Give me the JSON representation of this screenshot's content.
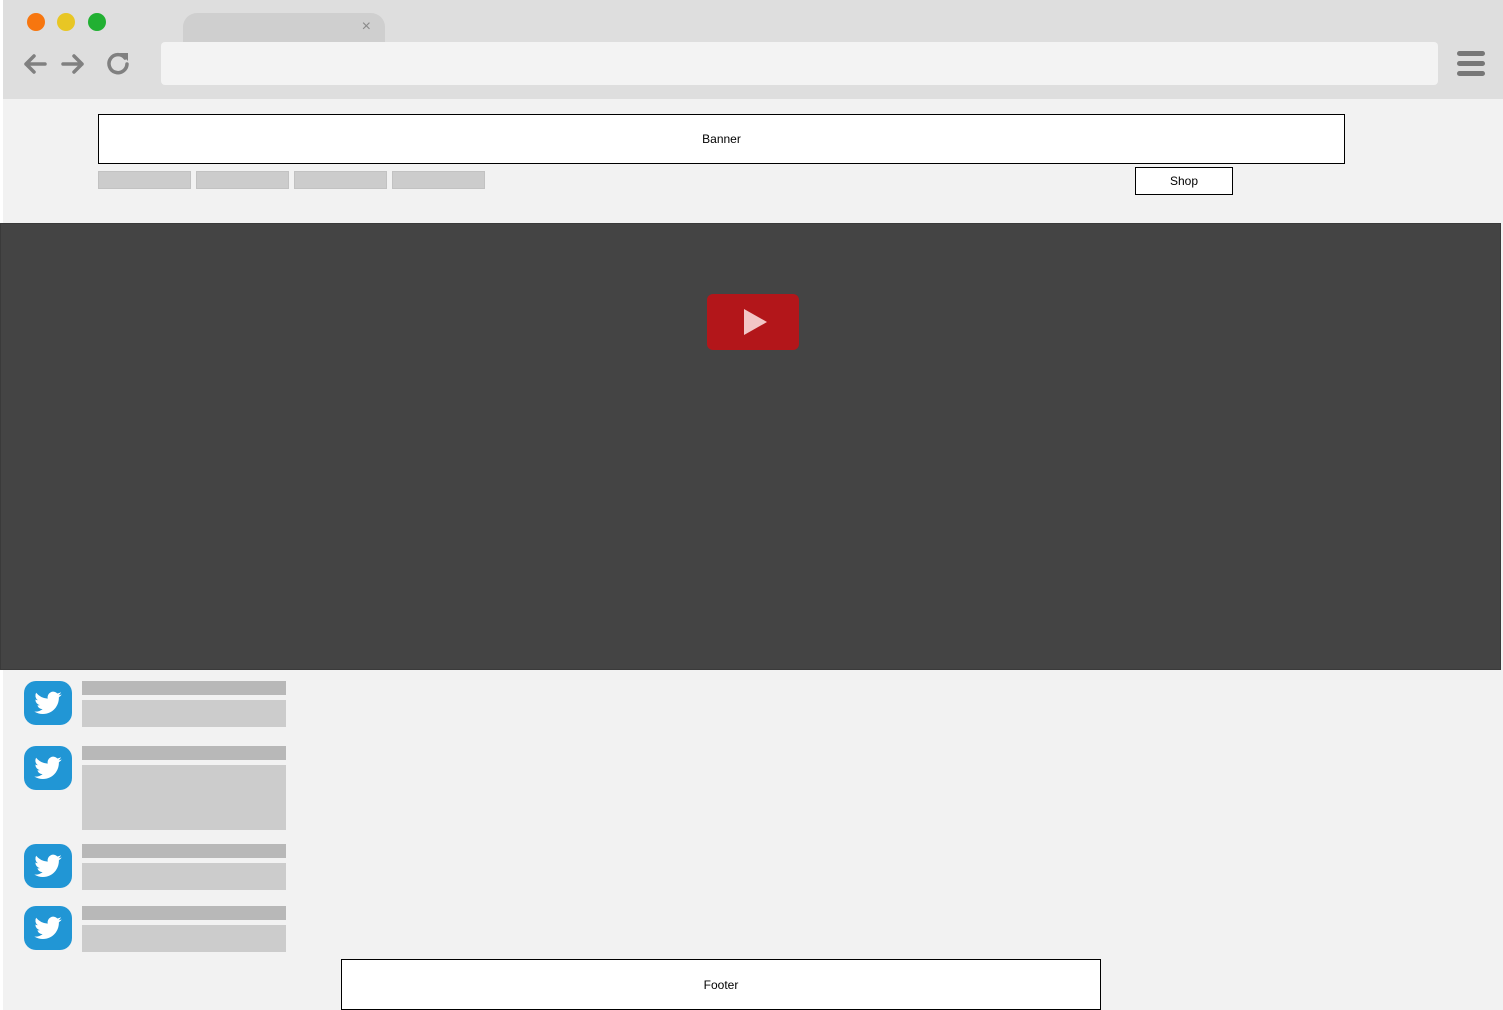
{
  "browser": {
    "window_controls": [
      "close",
      "minimize",
      "maximize"
    ],
    "tab": {
      "close_glyph": "×"
    },
    "address_bar": {
      "value": ""
    },
    "icons": {
      "back": "arrow-left-icon",
      "forward": "arrow-right-icon",
      "reload": "reload-icon",
      "menu": "hamburger-menu-icon"
    }
  },
  "page": {
    "banner": {
      "label": "Banner"
    },
    "nav_tabs": [
      "",
      "",
      "",
      ""
    ],
    "shop_button": {
      "label": "Shop"
    },
    "video": {
      "icon": "play-icon",
      "accent": "#b3161a"
    },
    "tweets": [
      {
        "icon": "twitter-icon"
      },
      {
        "icon": "twitter-icon"
      },
      {
        "icon": "twitter-icon"
      },
      {
        "icon": "twitter-icon"
      }
    ],
    "footer": {
      "label": "Footer"
    }
  },
  "colors": {
    "chrome_bg": "#dedede",
    "page_bg": "#f2f2f2",
    "video_bg": "#444444",
    "twitter_blue": "#2196d5",
    "placeholder_gray": "#cccccc"
  }
}
